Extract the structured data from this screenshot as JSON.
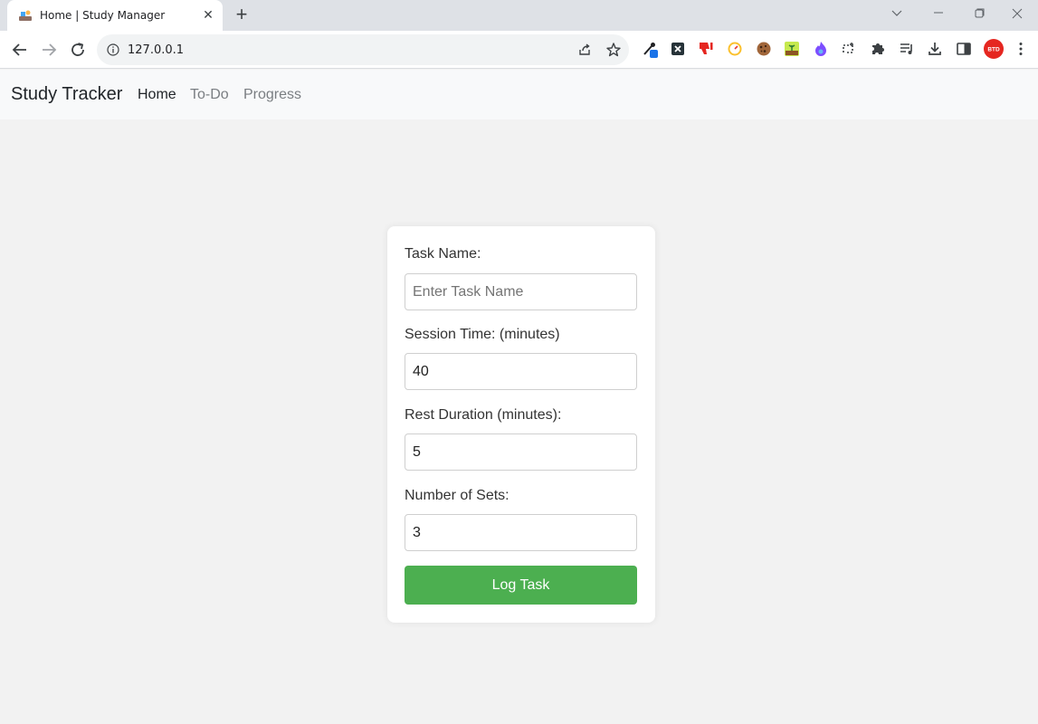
{
  "browser": {
    "tab_title": "Home | Study Manager",
    "url": "127.0.0.1",
    "new_tab_symbol": "+",
    "close_symbol": "✕",
    "extensions": [
      "eyedropper-icon",
      "x-icon",
      "dislike-icon",
      "speed-icon",
      "cookie-icon",
      "plant-icon",
      "flame-icon",
      "screenshot-icon",
      "puzzle-icon",
      "media-icon",
      "download-icon",
      "sidepanel-icon",
      "profile-icon"
    ],
    "profile_badge_text": "BTD",
    "profile_color": "#e52620"
  },
  "navbar": {
    "brand": "Study Tracker",
    "links": [
      {
        "label": "Home",
        "active": true
      },
      {
        "label": "To-Do",
        "active": false
      },
      {
        "label": "Progress",
        "active": false
      }
    ]
  },
  "form": {
    "task_name": {
      "label": "Task Name:",
      "placeholder": "Enter Task Name",
      "value": ""
    },
    "session_time": {
      "label": "Session Time: (minutes)",
      "value": "40"
    },
    "rest_duration": {
      "label": "Rest Duration (minutes):",
      "value": "5"
    },
    "sets": {
      "label": "Number of Sets:",
      "value": "3"
    },
    "submit_label": "Log Task",
    "accent_color": "#4caf50"
  }
}
